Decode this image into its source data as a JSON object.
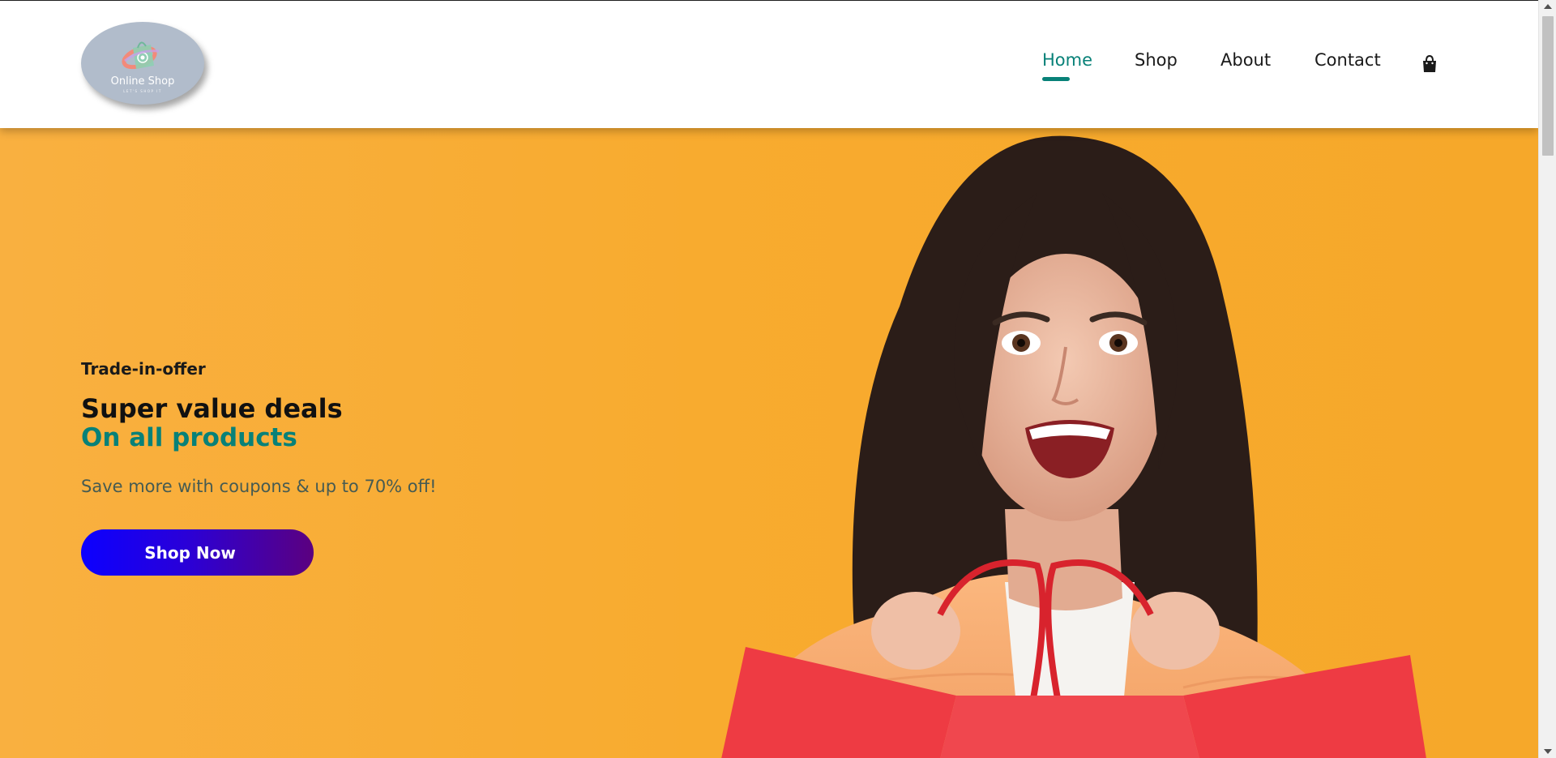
{
  "header": {
    "logo": {
      "name": "Online Shop",
      "tagline": "LET'S SHOP IT",
      "icon": "shopping-bag-logo-icon"
    },
    "nav": [
      {
        "label": "Home",
        "active": true
      },
      {
        "label": "Shop",
        "active": false
      },
      {
        "label": "About",
        "active": false
      },
      {
        "label": "Contact",
        "active": false
      }
    ],
    "cart_icon": "shopping-bag-icon"
  },
  "hero": {
    "eyebrow": "Trade-in-offer",
    "headline": "Super value deals",
    "headline_accent": "On all products",
    "subtext": "Save more with coupons & up to 70% off!",
    "cta_label": "Shop Now",
    "image_icon": "smiling-woman-with-shopping-bag-photo"
  },
  "colors": {
    "accent": "#088178",
    "hero_background": "#f8ab2f",
    "cta_gradient_start": "#0c00ff",
    "cta_gradient_end": "#5b007f",
    "logo_background": "#b1bccb"
  }
}
